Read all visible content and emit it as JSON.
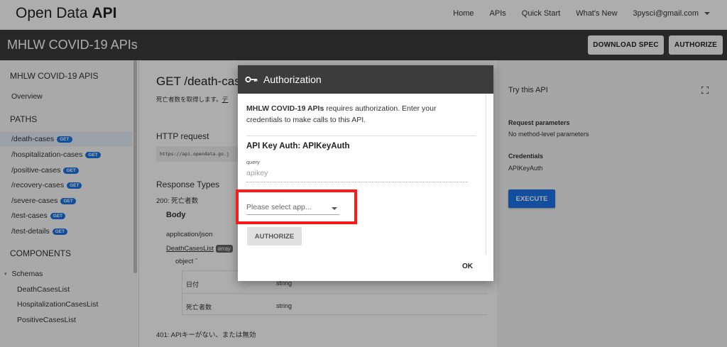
{
  "topnav": {
    "brand_prefix": "Open Data",
    "brand_bold": "API",
    "links": [
      "Home",
      "APIs",
      "Quick Start",
      "What's New"
    ],
    "account": "3pysci@gmail.com"
  },
  "apibar": {
    "title": "MHLW COVID-19 APIs",
    "download_label": "DOWNLOAD SPEC",
    "authorize_label": "AUTHORIZE"
  },
  "sidebar": {
    "heading": "MHLW COVID-19 APIS",
    "overview": "Overview",
    "paths_heading": "PATHS",
    "paths": [
      {
        "label": "/death-cases",
        "badge": "GET"
      },
      {
        "label": "/hospitalization-cases",
        "badge": "GET"
      },
      {
        "label": "/positive-cases",
        "badge": "GET"
      },
      {
        "label": "/recovery-cases",
        "badge": "GET"
      },
      {
        "label": "/severe-cases",
        "badge": "GET"
      },
      {
        "label": "/test-cases",
        "badge": "GET"
      },
      {
        "label": "/test-details",
        "badge": "GET"
      }
    ],
    "components_heading": "COMPONENTS",
    "schemas_label": "Schemas",
    "schemas": [
      "DeathCasesList",
      "HospitalizationCasesList",
      "PositiveCasesList"
    ]
  },
  "main": {
    "title": "GET /death-cas",
    "description": "死亡者数を取得します。",
    "description_link": "デ",
    "http_heading": "HTTP request",
    "http_url": "https://api.opendata.go.j",
    "response_heading": "Response Types",
    "r200": "200: 死亡者数",
    "body_heading": "Body",
    "content_type": "application/json",
    "schema_link": "DeathCasesList",
    "schema_chip": "array",
    "object_label": "object",
    "fields": [
      {
        "name": "日付",
        "type": "string"
      },
      {
        "name": "死亡者数",
        "type": "string"
      }
    ],
    "r401": "401: APIキーがない、または無効"
  },
  "right": {
    "try_label": "Try this API",
    "req_params_heading": "Request parameters",
    "req_params_value": "No method-level parameters",
    "credentials_heading": "Credentials",
    "credentials_value": "APIKeyAuth",
    "execute_label": "EXECUTE"
  },
  "modal": {
    "title": "Authorization",
    "intro_bold": "MHLW COVID-19 APIs",
    "intro_rest": " requires authorization. Enter your credentials to make calls to this API.",
    "auth_heading": "API Key Auth: APIKeyAuth",
    "param_location": "query",
    "apikey_placeholder": "apikey",
    "select_placeholder": "Please select app...",
    "authorize_label": "AUTHORIZE",
    "ok_label": "OK"
  },
  "colors": {
    "accent": "#1a73e8",
    "header_dark": "#3c3c3c",
    "highlight": "#ff1a1a"
  }
}
